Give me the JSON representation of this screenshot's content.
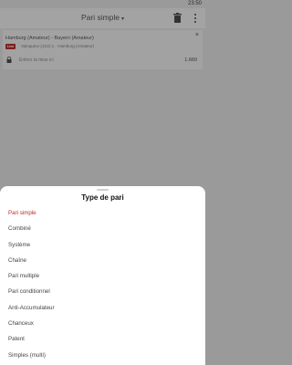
{
  "status_bar": {
    "time": "23:50"
  },
  "header": {
    "title": "Pari simple",
    "icons": [
      "chevron-down-icon",
      "trash-icon",
      "more-vert-icon"
    ]
  },
  "bet": {
    "match": "Hamburg (Amateur) - Bayern (Amateur)",
    "badge": "Live",
    "pick": "Vainqueur (1X2) 1 · Hamburg (Amateur)",
    "stake_placeholder": "Entrez la mise ici",
    "odds": "1.660",
    "close_icon": "close-icon",
    "lock_icon": "lock-icon"
  },
  "sheet": {
    "title": "Type de pari",
    "selected_index": 0,
    "accent_color": "#c62828",
    "options": [
      {
        "label": "Pari simple"
      },
      {
        "label": "Combiné"
      },
      {
        "label": "Système"
      },
      {
        "label": "Chaîne"
      },
      {
        "label": "Pari multiple"
      },
      {
        "label": "Pari conditionnel"
      },
      {
        "label": "Anti-Accumulateur"
      },
      {
        "label": "Chanceux"
      },
      {
        "label": "Patent"
      },
      {
        "label": "Simples (multi)"
      }
    ]
  }
}
